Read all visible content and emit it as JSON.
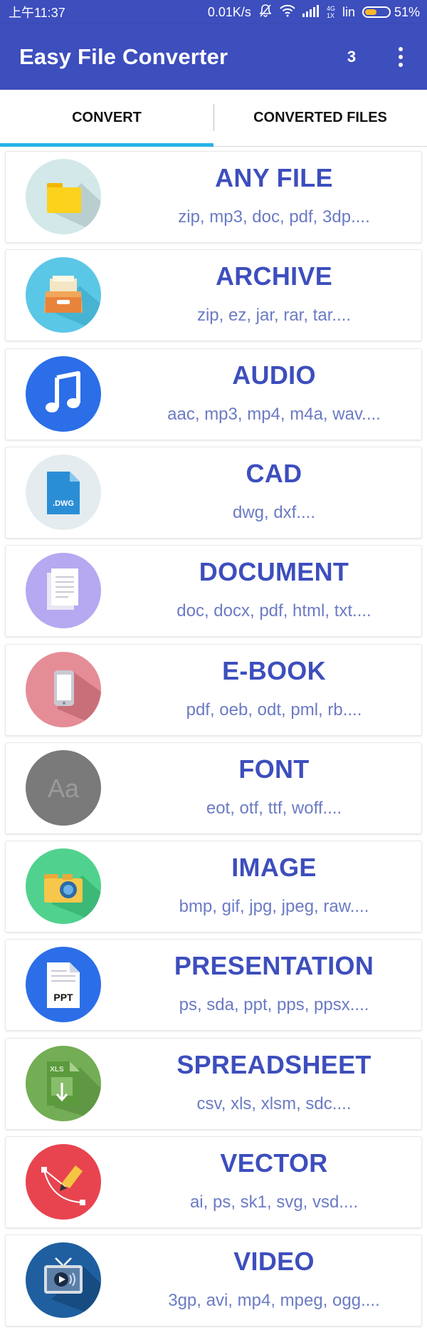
{
  "status_bar": {
    "time": "上午11:37",
    "speed": "0.01K/s",
    "network_top": "4G",
    "network_bottom": "1X",
    "carrier": "lin",
    "battery_text": "51%",
    "battery_level": 0.51
  },
  "app_bar": {
    "title": "Easy File Converter",
    "count": "3",
    "menu_icon": "more-vert-icon"
  },
  "tabs": [
    {
      "label": "CONVERT",
      "selected": true
    },
    {
      "label": "CONVERTED FILES",
      "selected": false
    }
  ],
  "colors": {
    "primary": "#3d4ebd",
    "indicator": "#29b2e6",
    "title_text": "#3d4ebd",
    "subtitle_text": "#6b7bc4"
  },
  "categories": [
    {
      "title": "ANY FILE",
      "formats": "zip, mp3, doc, pdf, 3dp....",
      "icon": "folder-icon"
    },
    {
      "title": "ARCHIVE",
      "formats": "zip, ez, jar, rar, tar....",
      "icon": "archive-tray-icon"
    },
    {
      "title": "AUDIO",
      "formats": "aac, mp3, mp4, m4a, wav....",
      "icon": "music-note-icon"
    },
    {
      "title": "CAD",
      "formats": "dwg, dxf....",
      "icon": "dwg-file-icon",
      "icon_label": ".DWG"
    },
    {
      "title": "DOCUMENT",
      "formats": "doc, docx, pdf, html, txt....",
      "icon": "document-icon"
    },
    {
      "title": "E-BOOK",
      "formats": "pdf, oeb, odt, pml, rb....",
      "icon": "tablet-icon"
    },
    {
      "title": "FONT",
      "formats": "eot, otf, ttf, woff....",
      "icon": "font-icon",
      "icon_label": "Aa"
    },
    {
      "title": "IMAGE",
      "formats": "bmp, gif, jpg, jpeg, raw....",
      "icon": "camera-folder-icon"
    },
    {
      "title": "PRESENTATION",
      "formats": "ps, sda, ppt, pps, ppsx....",
      "icon": "ppt-file-icon",
      "icon_label": "PPT"
    },
    {
      "title": "SPREADSHEET",
      "formats": "csv, xls, xlsm, sdc....",
      "icon": "xls-file-icon",
      "icon_label": "XLS"
    },
    {
      "title": "VECTOR",
      "formats": "ai, ps, sk1, svg, vsd....",
      "icon": "pen-vector-icon"
    },
    {
      "title": "VIDEO",
      "formats": "3gp, avi, mp4, mpeg, ogg....",
      "icon": "tv-play-icon"
    }
  ]
}
